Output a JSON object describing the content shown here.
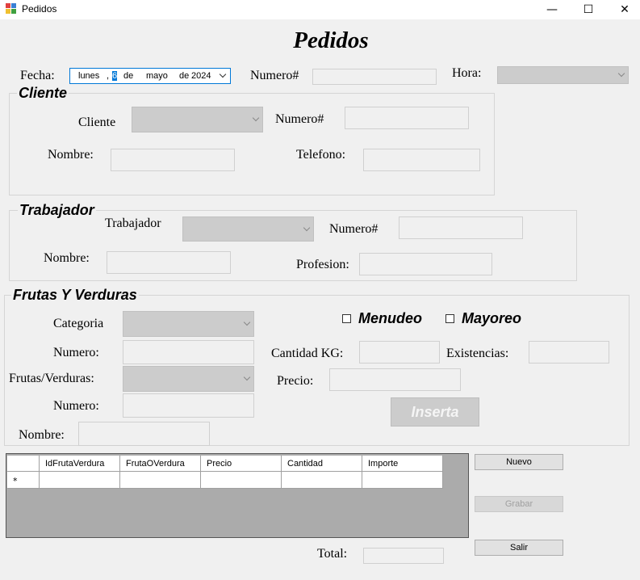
{
  "window": {
    "title": "Pedidos",
    "minimize": "—",
    "maximize": "☐",
    "close": "✕"
  },
  "header": {
    "title": "Pedidos"
  },
  "top": {
    "fecha_label": "Fecha:",
    "date": {
      "weekday": "lunes",
      "sep": ",",
      "day": "6",
      "de1": "de",
      "month": "mayo",
      "de2": "de",
      "year": "2024"
    },
    "numero_label": "Numero#",
    "hora_label": "Hora:"
  },
  "cliente": {
    "group_title": "Cliente",
    "cliente_label": "Cliente",
    "numero_label": "Numero#",
    "nombre_label": "Nombre:",
    "telefono_label": "Telefono:"
  },
  "trabajador": {
    "group_title": "Trabajador",
    "trabajador_label": "Trabajador",
    "numero_label": "Numero#",
    "nombre_label": "Nombre:",
    "profesion_label": "Profesion:"
  },
  "frutas": {
    "group_title": "Frutas Y Verduras",
    "categoria_label": "Categoria",
    "numero_label": "Numero:",
    "frutas_label": "Frutas/Verduras:",
    "numero2_label": "Numero:",
    "nombre_label": "Nombre:",
    "menudeo_label": "Menudeo",
    "mayoreo_label": "Mayoreo",
    "cantidad_label": "Cantidad KG:",
    "existencias_label": "Existencias:",
    "precio_label": "Precio:",
    "inserta_label": "Inserta"
  },
  "grid": {
    "columns": [
      "IdFrutaVerdura",
      "FrutaOVerdura",
      "Precio",
      "Cantidad",
      "Importe"
    ],
    "new_row_marker": "*"
  },
  "actions": {
    "nuevo": "Nuevo",
    "grabar": "Grabar",
    "salir": "Salir"
  },
  "footer": {
    "total_label": "Total:"
  }
}
